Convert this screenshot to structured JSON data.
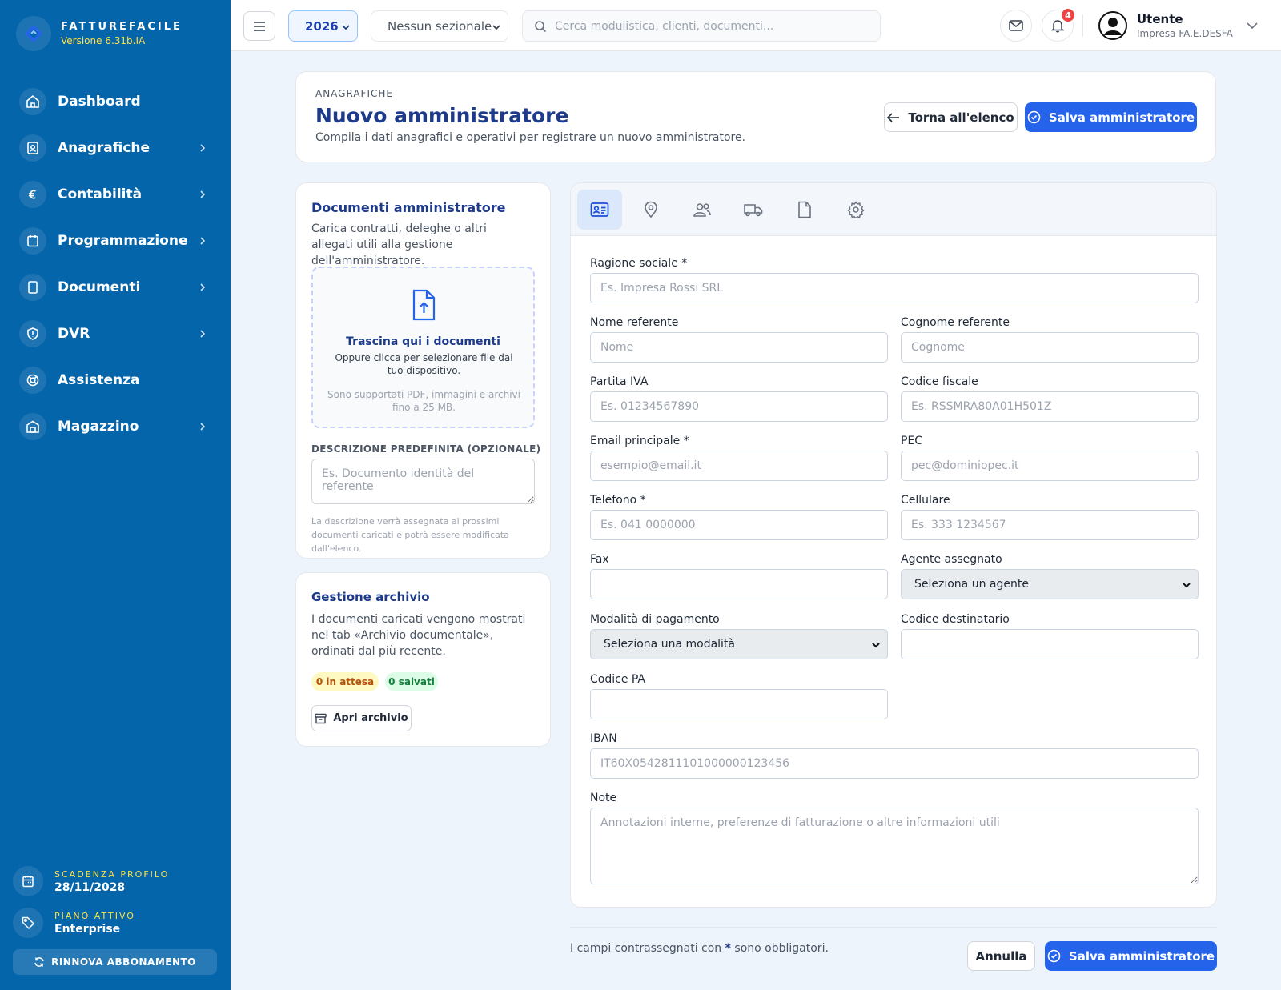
{
  "sidebar": {
    "brand_name": "FATTUREFACILE",
    "version": "Versione 6.31b.IA",
    "items": [
      {
        "label": "Dashboard",
        "icon": "home-icon"
      },
      {
        "label": "Anagrafiche",
        "icon": "contacts-icon"
      },
      {
        "label": "Contabilità",
        "icon": "euro-icon"
      },
      {
        "label": "Programmazione",
        "icon": "calendar-icon"
      },
      {
        "label": "Documenti",
        "icon": "document-icon"
      },
      {
        "label": "DVR",
        "icon": "shield-icon"
      },
      {
        "label": "Assistenza",
        "icon": "lifebuoy-icon"
      },
      {
        "label": "Magazzino",
        "icon": "warehouse-icon"
      }
    ],
    "scadenza_label": "SCADENZA PROFILO",
    "scadenza_value": "28/11/2028",
    "piano_label": "PIANO ATTIVO",
    "piano_value": "Enterprise",
    "renew_label": "RINNOVA ABBONAMENTO"
  },
  "topbar": {
    "year": "2026",
    "sezionale": "Nessun sezionale",
    "search_placeholder": "Cerca modulistica, clienti, documenti...",
    "notifications_count": "4",
    "user_name": "Utente",
    "user_company": "Impresa FA.E.DESFA"
  },
  "header": {
    "kicker": "ANAGRAFICHE",
    "title": "Nuovo amministratore",
    "subtitle": "Compila i dati anagrafici e operativi per registrare un nuovo amministratore.",
    "back_label": "Torna all'elenco",
    "save_label": "Salva amministratore"
  },
  "docs": {
    "title": "Documenti amministratore",
    "description": "Carica contratti, deleghe o altri allegati utili alla gestione dell'amministratore.",
    "drop_title": "Trascina qui i documenti",
    "drop_sub": "Oppure clicca per selezionare file dal tuo dispositivo.",
    "drop_note": "Sono supportati PDF, immagini e archivi fino a 25 MB.",
    "desc_label": "DESCRIZIONE PREDEFINITA (OPZIONALE)",
    "desc_placeholder": "Es. Documento identità del referente",
    "help": "La descrizione verrà assegnata ai prossimi documenti caricati e potrà essere modificata dall'elenco."
  },
  "archive": {
    "title": "Gestione archivio",
    "text": "I documenti caricati vengono mostrati nel tab «Archivio documentale», ordinati dal più recente.",
    "pending": "0 in attesa",
    "saved": "0 salvati",
    "open_label": "Apri archivio"
  },
  "form": {
    "tabs": [
      "id-card-icon",
      "map-pin-icon",
      "users-icon",
      "truck-icon",
      "file-icon",
      "gear-icon"
    ],
    "ragione_sociale": {
      "label": "Ragione sociale *",
      "placeholder": "Es. Impresa Rossi SRL"
    },
    "nome": {
      "label": "Nome referente",
      "placeholder": "Nome"
    },
    "cognome": {
      "label": "Cognome referente",
      "placeholder": "Cognome"
    },
    "piva": {
      "label": "Partita IVA",
      "placeholder": "Es. 01234567890"
    },
    "cf": {
      "label": "Codice fiscale",
      "placeholder": "Es. RSSMRA80A01H501Z"
    },
    "email": {
      "label": "Email principale *",
      "placeholder": "esempio@email.it"
    },
    "pec": {
      "label": "PEC",
      "placeholder": "pec@dominiopec.it"
    },
    "telefono": {
      "label": "Telefono *",
      "placeholder": "Es. 041 0000000"
    },
    "cellulare": {
      "label": "Cellulare",
      "placeholder": "Es. 333 1234567"
    },
    "fax": {
      "label": "Fax",
      "placeholder": ""
    },
    "agente": {
      "label": "Agente assegnato",
      "value": "Seleziona un agente"
    },
    "pagamento": {
      "label": "Modalità di pagamento",
      "value": "Seleziona una modalità"
    },
    "cod_dest": {
      "label": "Codice destinatario",
      "placeholder": ""
    },
    "cod_pa": {
      "label": "Codice PA",
      "placeholder": ""
    },
    "iban": {
      "label": "IBAN",
      "placeholder": "IT60X0542811101000000123456"
    },
    "note": {
      "label": "Note",
      "placeholder": "Annotazioni interne, preferenze di fatturazione o altre informazioni utili"
    }
  },
  "footer": {
    "note_before": "I campi contrassegnati con",
    "note_star": "*",
    "note_after": "sono obbligatori.",
    "cancel_label": "Annulla",
    "save_label": "Salva amministratore"
  },
  "colors": {
    "sidebar": "#0565ab",
    "primary": "#2563eb",
    "title": "#1e3a8a",
    "accent_yellow": "#fde047",
    "badge_red": "#ef4444"
  }
}
